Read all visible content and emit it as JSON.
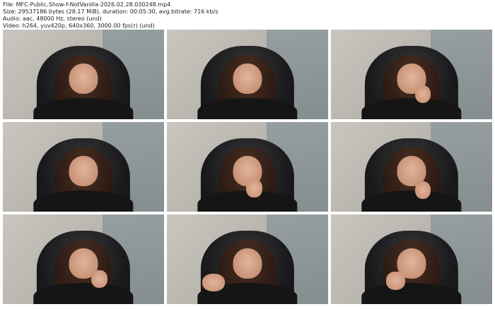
{
  "info": {
    "file": "File: MFC-Public.Show-f-NotVanilla-2026.02.28.030248.mp4",
    "size": "Size: 29537186 bytes (28.17 MiB), duration: 00:05:30, avg.bitrate: 716 kb/s",
    "audio": "Audio: aac, 48000 Hz, stereo (und)",
    "video": "Video: h264, yuv420p, 640x360, 3000.00 fps(r) (und)"
  }
}
